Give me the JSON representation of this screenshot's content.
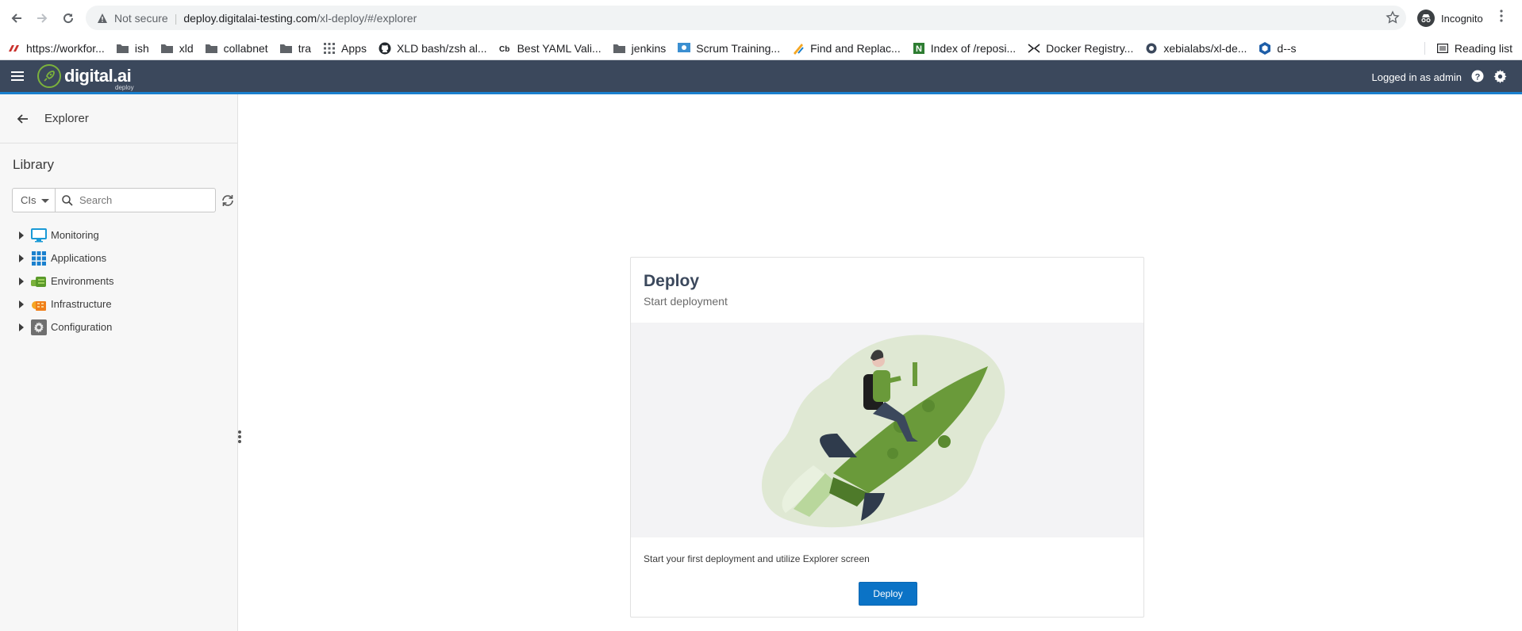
{
  "browser": {
    "security_label": "Not secure",
    "url_host": "deploy.digitalai-testing.com",
    "url_path": "/xl-deploy/#/explorer",
    "profile_label": "Incognito"
  },
  "bookmarks": [
    {
      "label": "https://workfor...",
      "icon": "site-icon"
    },
    {
      "label": "ish",
      "icon": "folder-icon"
    },
    {
      "label": "xld",
      "icon": "folder-icon"
    },
    {
      "label": "collabnet",
      "icon": "folder-icon"
    },
    {
      "label": "tra",
      "icon": "folder-icon"
    },
    {
      "label": "Apps",
      "icon": "apps-grid-icon"
    },
    {
      "label": "XLD bash/zsh al...",
      "icon": "github-icon"
    },
    {
      "label": "Best YAML Vali...",
      "icon": "cb-icon"
    },
    {
      "label": "jenkins",
      "icon": "folder-icon"
    },
    {
      "label": "Scrum Training...",
      "icon": "site-icon"
    },
    {
      "label": "Find and Replac...",
      "icon": "site-icon"
    },
    {
      "label": "Index of /reposi...",
      "icon": "n-icon"
    },
    {
      "label": "Docker Registry...",
      "icon": "docker-icon"
    },
    {
      "label": "xebialabs/xl-de...",
      "icon": "site-icon"
    },
    {
      "label": "d--s",
      "icon": "hex-icon"
    }
  ],
  "reading_list_label": "Reading list",
  "app": {
    "logo_text": "digital.ai",
    "logo_sub": "deploy",
    "logged_in_text": "Logged in as admin",
    "brand_color": "#3b485c",
    "accent_color": "#1a80ce"
  },
  "sidebar": {
    "title": "Explorer",
    "library_title": "Library",
    "ci_select_value": "CIs",
    "search_placeholder": "Search",
    "tree": [
      {
        "label": "Monitoring",
        "icon": "monitor-icon"
      },
      {
        "label": "Applications",
        "icon": "applications-grid-icon"
      },
      {
        "label": "Environments",
        "icon": "environments-icon"
      },
      {
        "label": "Infrastructure",
        "icon": "infrastructure-icon"
      },
      {
        "label": "Configuration",
        "icon": "configuration-gear-icon"
      }
    ]
  },
  "card": {
    "title": "Deploy",
    "subtitle": "Start deployment",
    "text": "Start your first deployment and utilize Explorer screen",
    "button_label": "Deploy"
  }
}
